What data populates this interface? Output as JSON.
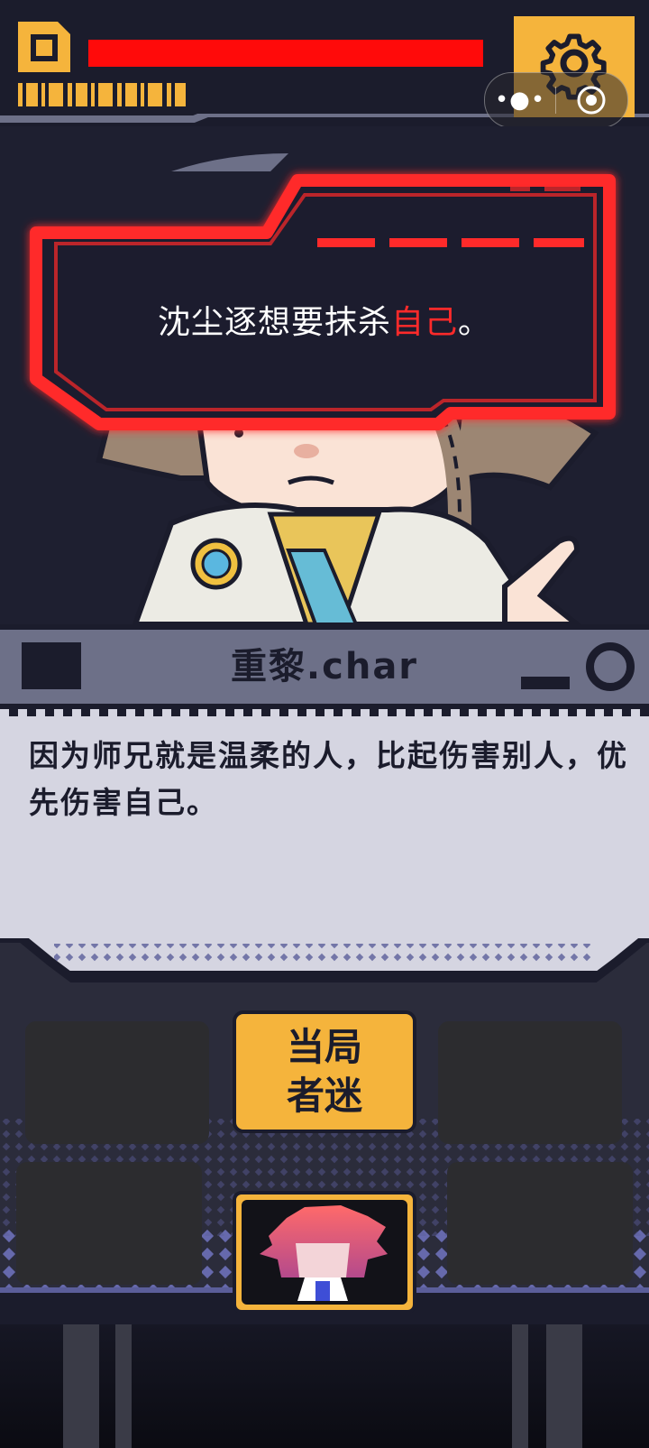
{
  "hud": {
    "health_fraction": 1.0
  },
  "alert": {
    "text_before": "沈尘逐想要抹杀",
    "text_highlight": "自己",
    "text_after": "。"
  },
  "speaker": {
    "name": "重黎.char"
  },
  "dialogue": {
    "text": "因为师兄就是温柔的人，比起伤害别人，优先伤害自己。"
  },
  "actions": {
    "deduce_label": "当局者迷"
  },
  "miniprogram_capsule": {
    "more_icon": "more-dots-icon",
    "close_icon": "target-close-icon"
  },
  "colors": {
    "accent": "#f5b43c",
    "alert_red": "#ff2a2a",
    "panel": "#6d7088",
    "dialogue_bg": "#d5d5e1",
    "background": "#1b1c2c"
  }
}
